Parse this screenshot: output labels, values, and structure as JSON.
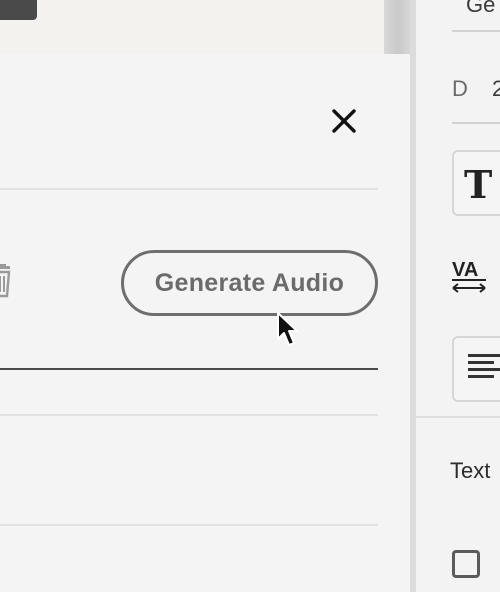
{
  "dialog": {
    "generate_button_label": "Generate Audio",
    "close_icon": "close-icon",
    "delete_icon": "trash-icon"
  },
  "right_panel": {
    "top_text": "Ge",
    "d_label": "D",
    "d_value": "2",
    "text_icon": "T",
    "tracking_icon": "VA",
    "align_icon": "align-left-icon",
    "section_label": "Text",
    "checkbox_state": "unchecked"
  },
  "colors": {
    "panel_bg": "#f4f4f4",
    "button_border": "#6e6e6e",
    "button_text": "#6b6b6b"
  }
}
